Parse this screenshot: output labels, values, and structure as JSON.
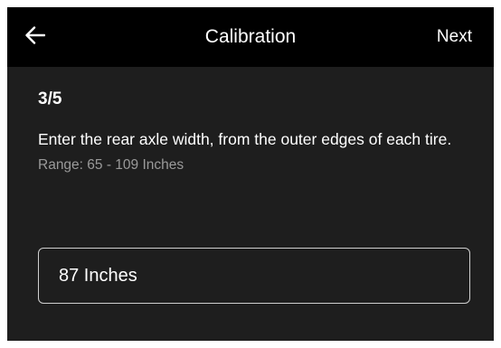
{
  "header": {
    "title": "Calibration",
    "back_icon": "arrow-left-icon",
    "next_label": "Next"
  },
  "content": {
    "step": "3/5",
    "instruction": "Enter the rear axle width, from the outer edges of each tire.",
    "range": "Range: 65 - 109 Inches"
  },
  "input": {
    "value": "87 Inches"
  },
  "colors": {
    "header_bg": "#000000",
    "screen_bg": "#1e1e1e",
    "text": "#ffffff",
    "muted_text": "#9a9a9a",
    "input_border": "#cfcfcf"
  }
}
